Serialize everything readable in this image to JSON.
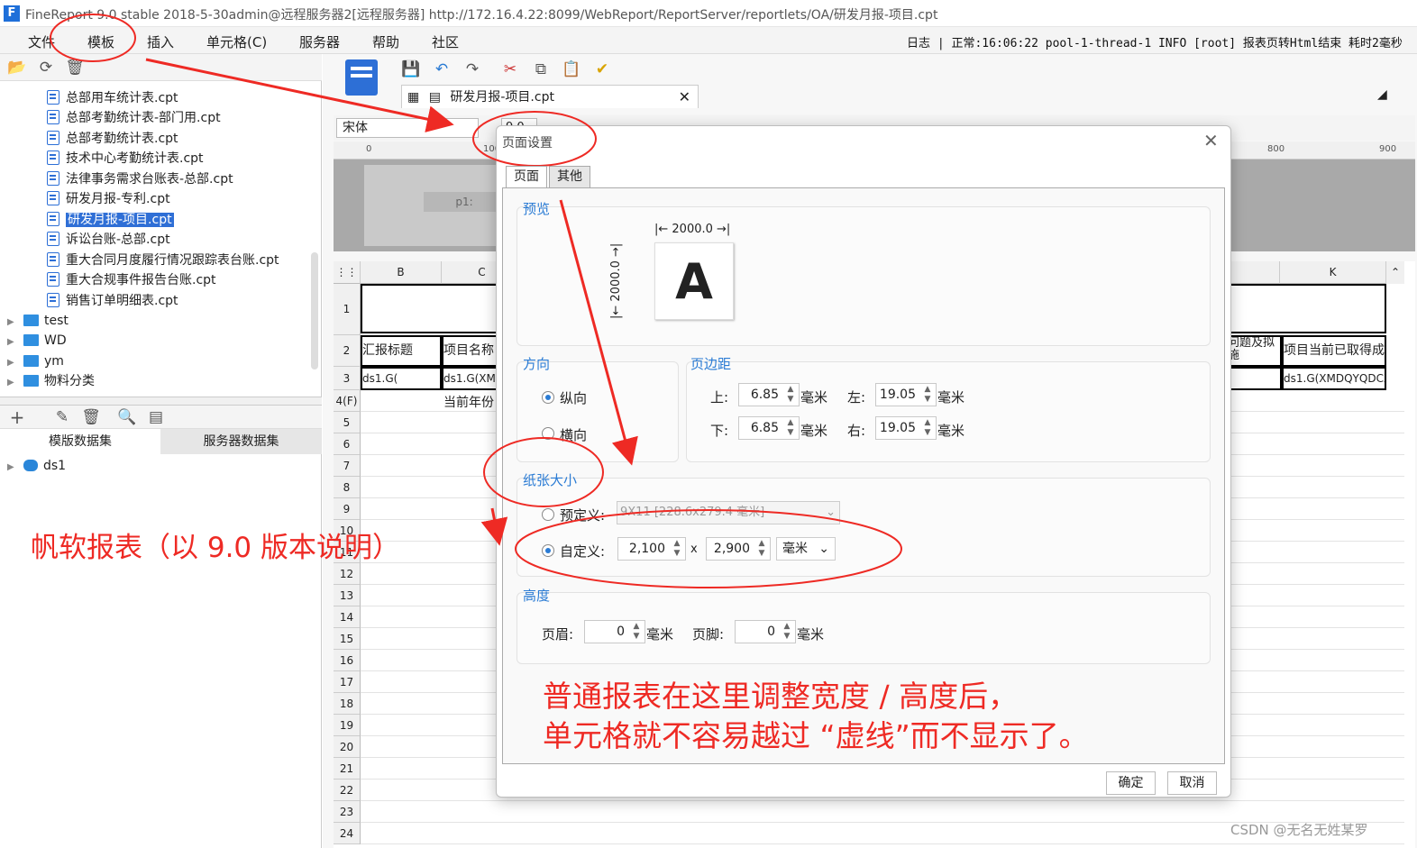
{
  "window": {
    "title": "FineReport 9.0 stable 2018-5-30admin@远程服务器2[远程服务器]    http://172.16.4.22:8099/WebReport/ReportServer/reportlets/OA/研发月报-项目.cpt",
    "logo": "F"
  },
  "menu": [
    "文件",
    "模板",
    "插入",
    "单元格(C)",
    "服务器",
    "帮助",
    "社区"
  ],
  "status": "日志 | 正常:16:06:22 pool-1-thread-1 INFO [root] 报表页转Html结束 耗时2毫秒",
  "tree": {
    "files": [
      "总部用车统计表.cpt",
      "总部考勤统计表-部门用.cpt",
      "总部考勤统计表.cpt",
      "技术中心考勤统计表.cpt",
      "法律事务需求台账表-总部.cpt",
      "研发月报-专利.cpt",
      "研发月报-项目.cpt",
      "诉讼台账-总部.cpt",
      "重大合同月度履行情况跟踪表台账.cpt",
      "重大合规事件报告台账.cpt",
      "销售订单明细表.cpt"
    ],
    "selected_index": 6,
    "folders": [
      "test",
      "WD",
      "ym",
      "物料分类"
    ]
  },
  "dataset_tabs": [
    "模版数据集",
    "服务器数据集"
  ],
  "dataset_items": [
    "ds1"
  ],
  "editor": {
    "tab_title": "研发月报-项目.cpt",
    "font_name": "宋体",
    "font_size": "9.0",
    "ruler": [
      "0",
      "100",
      "800",
      "900"
    ],
    "page_label": "p1:",
    "columns": [
      "B",
      "C",
      "K"
    ],
    "rows": [
      "1",
      "2",
      "3",
      "4(F)",
      "5",
      "6",
      "7",
      "8",
      "9",
      "10",
      "11",
      "12",
      "13",
      "14",
      "15",
      "16",
      "17",
      "18",
      "19",
      "20",
      "21",
      "22",
      "23",
      "24"
    ],
    "cells": {
      "r2_b": "汇报标题",
      "r2_c": "项目名称",
      "r2_j": "问题及拟",
      "r2_j2": "施",
      "r2_k": "项目当前已取得成",
      "r3_b": "ds1.G(",
      "r3_c": "ds1.G(XM",
      "r3_j": ")",
      "r3_k": "ds1.G(XMDQYQDCX",
      "r4_c": "当前年份"
    }
  },
  "dialog": {
    "title": "页面设置",
    "tabs": [
      "页面",
      "其他"
    ],
    "preview": {
      "label": "预览",
      "width": "2000.0",
      "height": "2000.0",
      "letter": "A"
    },
    "orientation": {
      "label": "方向",
      "portrait": "纵向",
      "landscape": "横向",
      "selected": "portrait"
    },
    "margins": {
      "label": "页边距",
      "top_label": "上:",
      "top": "6.85",
      "bottom_label": "下:",
      "bottom": "6.85",
      "left_label": "左:",
      "left": "19.05",
      "right_label": "右:",
      "right": "19.05",
      "unit": "毫米"
    },
    "paper": {
      "label": "纸张大小",
      "preset_label": "预定义:",
      "preset_value": "9X11 [228.6x279.4 毫米]",
      "custom_label": "自定义:",
      "custom_w": "2,100",
      "x": "x",
      "custom_h": "2,900",
      "unit": "毫米",
      "selected": "custom"
    },
    "height": {
      "label": "高度",
      "header_label": "页眉:",
      "header": "0",
      "footer_label": "页脚:",
      "footer": "0",
      "unit": "毫米"
    },
    "ok": "确定",
    "cancel": "取消"
  },
  "annotations": {
    "left": "帆软报表（以 9.0 版本说明）",
    "line1": "普通报表在这里调整宽度 / 高度后，",
    "line2": "单元格就不容易越过 “虚线”而不显示了。"
  },
  "watermark": "CSDN @无名无姓某罗",
  "colors": {
    "accent": "#2a7bd4",
    "annotation": "#ee2a24",
    "selection": "#2f6fd6"
  }
}
